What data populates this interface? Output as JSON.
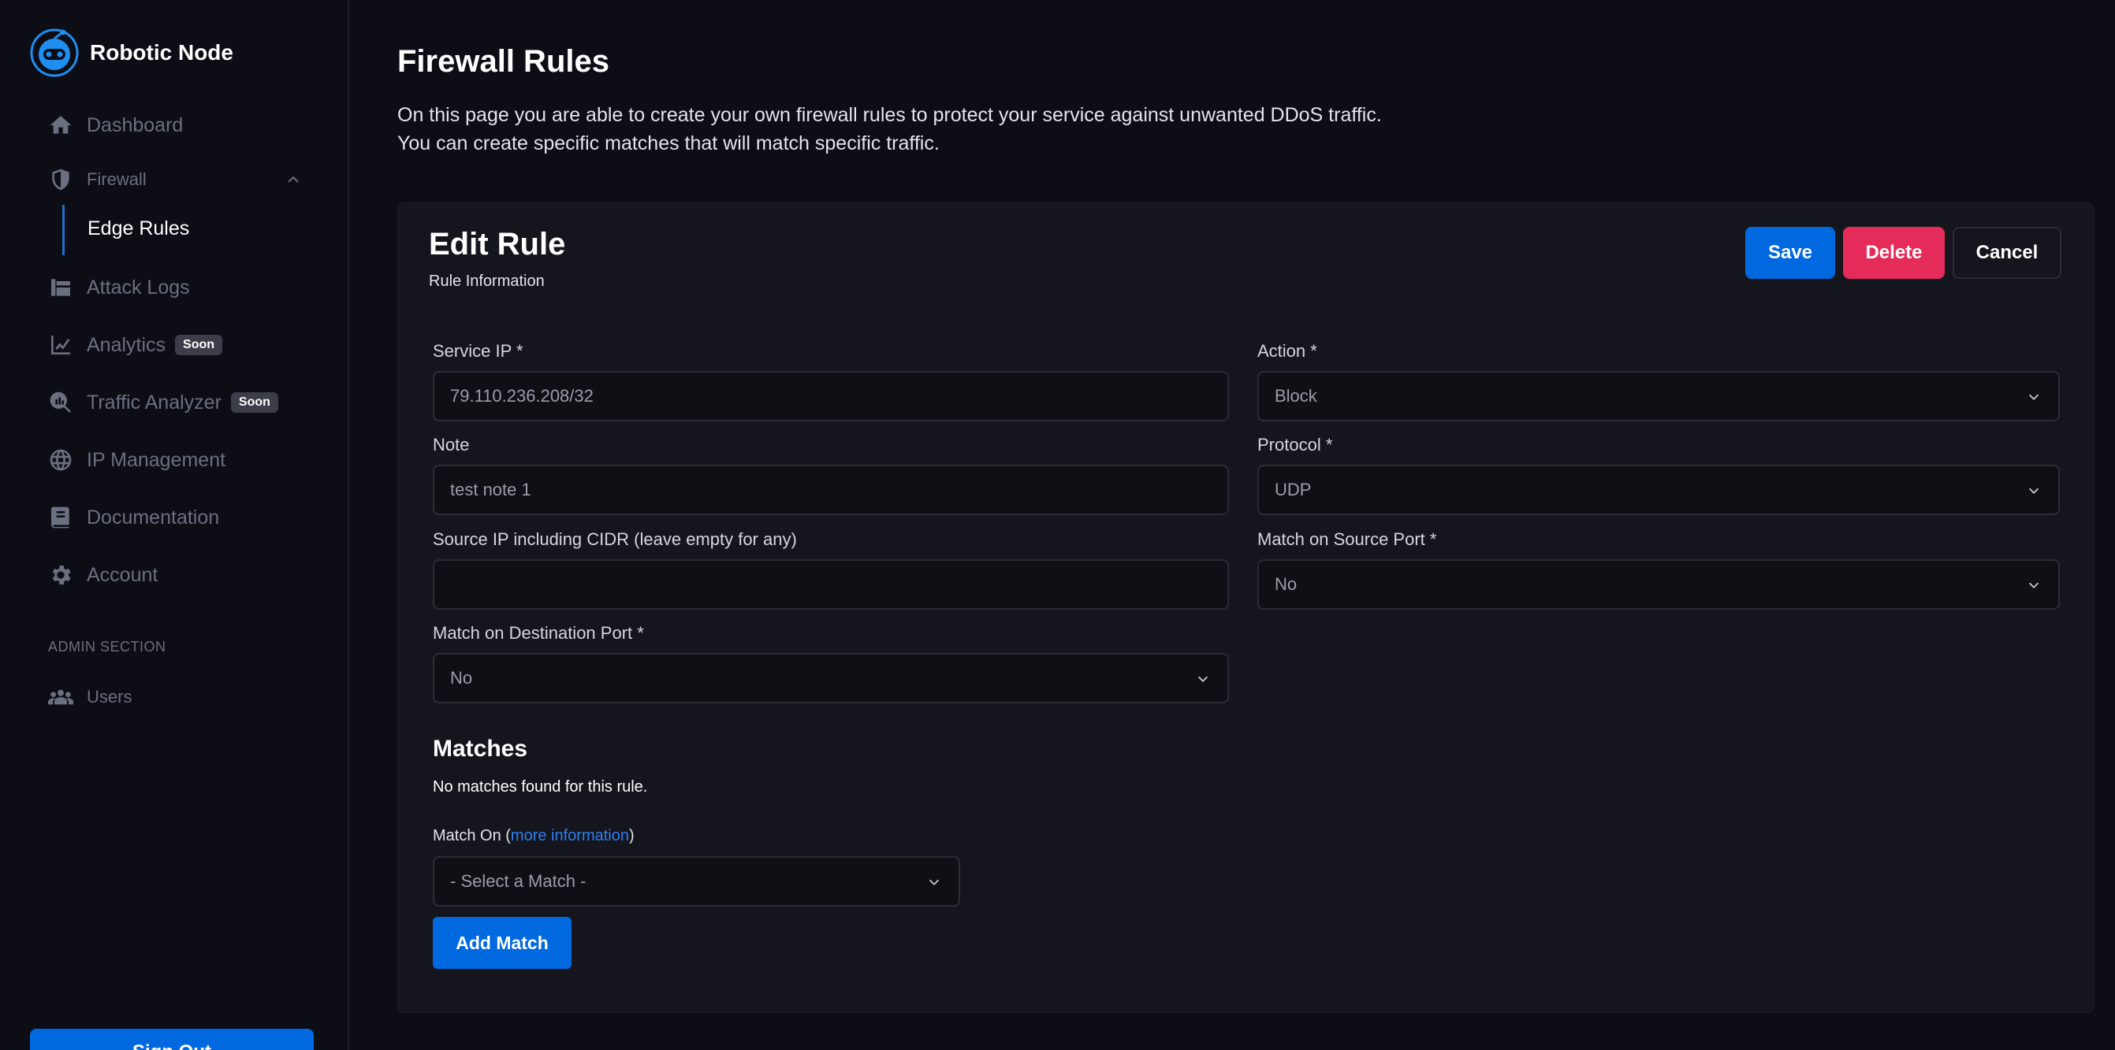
{
  "brand": {
    "name": "Robotic Node"
  },
  "sidebar": {
    "items": [
      {
        "label": "Dashboard",
        "icon": "home-icon"
      },
      {
        "label": "Firewall",
        "icon": "shield-icon"
      },
      {
        "label": "Edge Rules"
      },
      {
        "label": "Attack Logs",
        "icon": "logs-icon"
      },
      {
        "label": "Analytics",
        "icon": "chart-line-icon",
        "badge": "Soon"
      },
      {
        "label": "Traffic Analyzer",
        "icon": "magnifier-chart-icon",
        "badge": "Soon"
      },
      {
        "label": "IP Management",
        "icon": "globe-icon"
      },
      {
        "label": "Documentation",
        "icon": "book-icon"
      },
      {
        "label": "Account",
        "icon": "gear-icon"
      }
    ],
    "admin_label": "ADMIN SECTION",
    "admin_items": [
      {
        "label": "Users",
        "icon": "users-icon"
      }
    ],
    "signout_label": "Sign Out"
  },
  "page": {
    "title": "Firewall Rules",
    "desc_line1": "On this page you are able to create your own firewall rules to protect your service against unwanted DDoS traffic.",
    "desc_line2": "You can create specific matches that will match specific traffic."
  },
  "card": {
    "title": "Edit Rule",
    "subtitle": "Rule Information",
    "save_label": "Save",
    "delete_label": "Delete",
    "cancel_label": "Cancel"
  },
  "form": {
    "service_ip": {
      "label": "Service IP *",
      "value": "79.110.236.208/32"
    },
    "action": {
      "label": "Action *",
      "value": "Block"
    },
    "note": {
      "label": "Note",
      "value": "test note 1"
    },
    "protocol": {
      "label": "Protocol *",
      "value": "UDP"
    },
    "source_ip": {
      "label": "Source IP including CIDR (leave empty for any)",
      "value": ""
    },
    "match_source_port": {
      "label": "Match on Source Port *",
      "value": "No"
    },
    "match_dest_port": {
      "label": "Match on Destination Port *",
      "value": "No"
    }
  },
  "matches": {
    "title": "Matches",
    "empty_text": "No matches found for this rule.",
    "match_on_prefix": "Match On (",
    "match_on_link": "more information",
    "match_on_suffix": ")",
    "select_value": "- Select a Match -",
    "add_label": "Add Match"
  },
  "colors": {
    "accent": "#0069e0",
    "danger": "#e52b59",
    "background": "#0c0d15",
    "card": "#15161d"
  }
}
